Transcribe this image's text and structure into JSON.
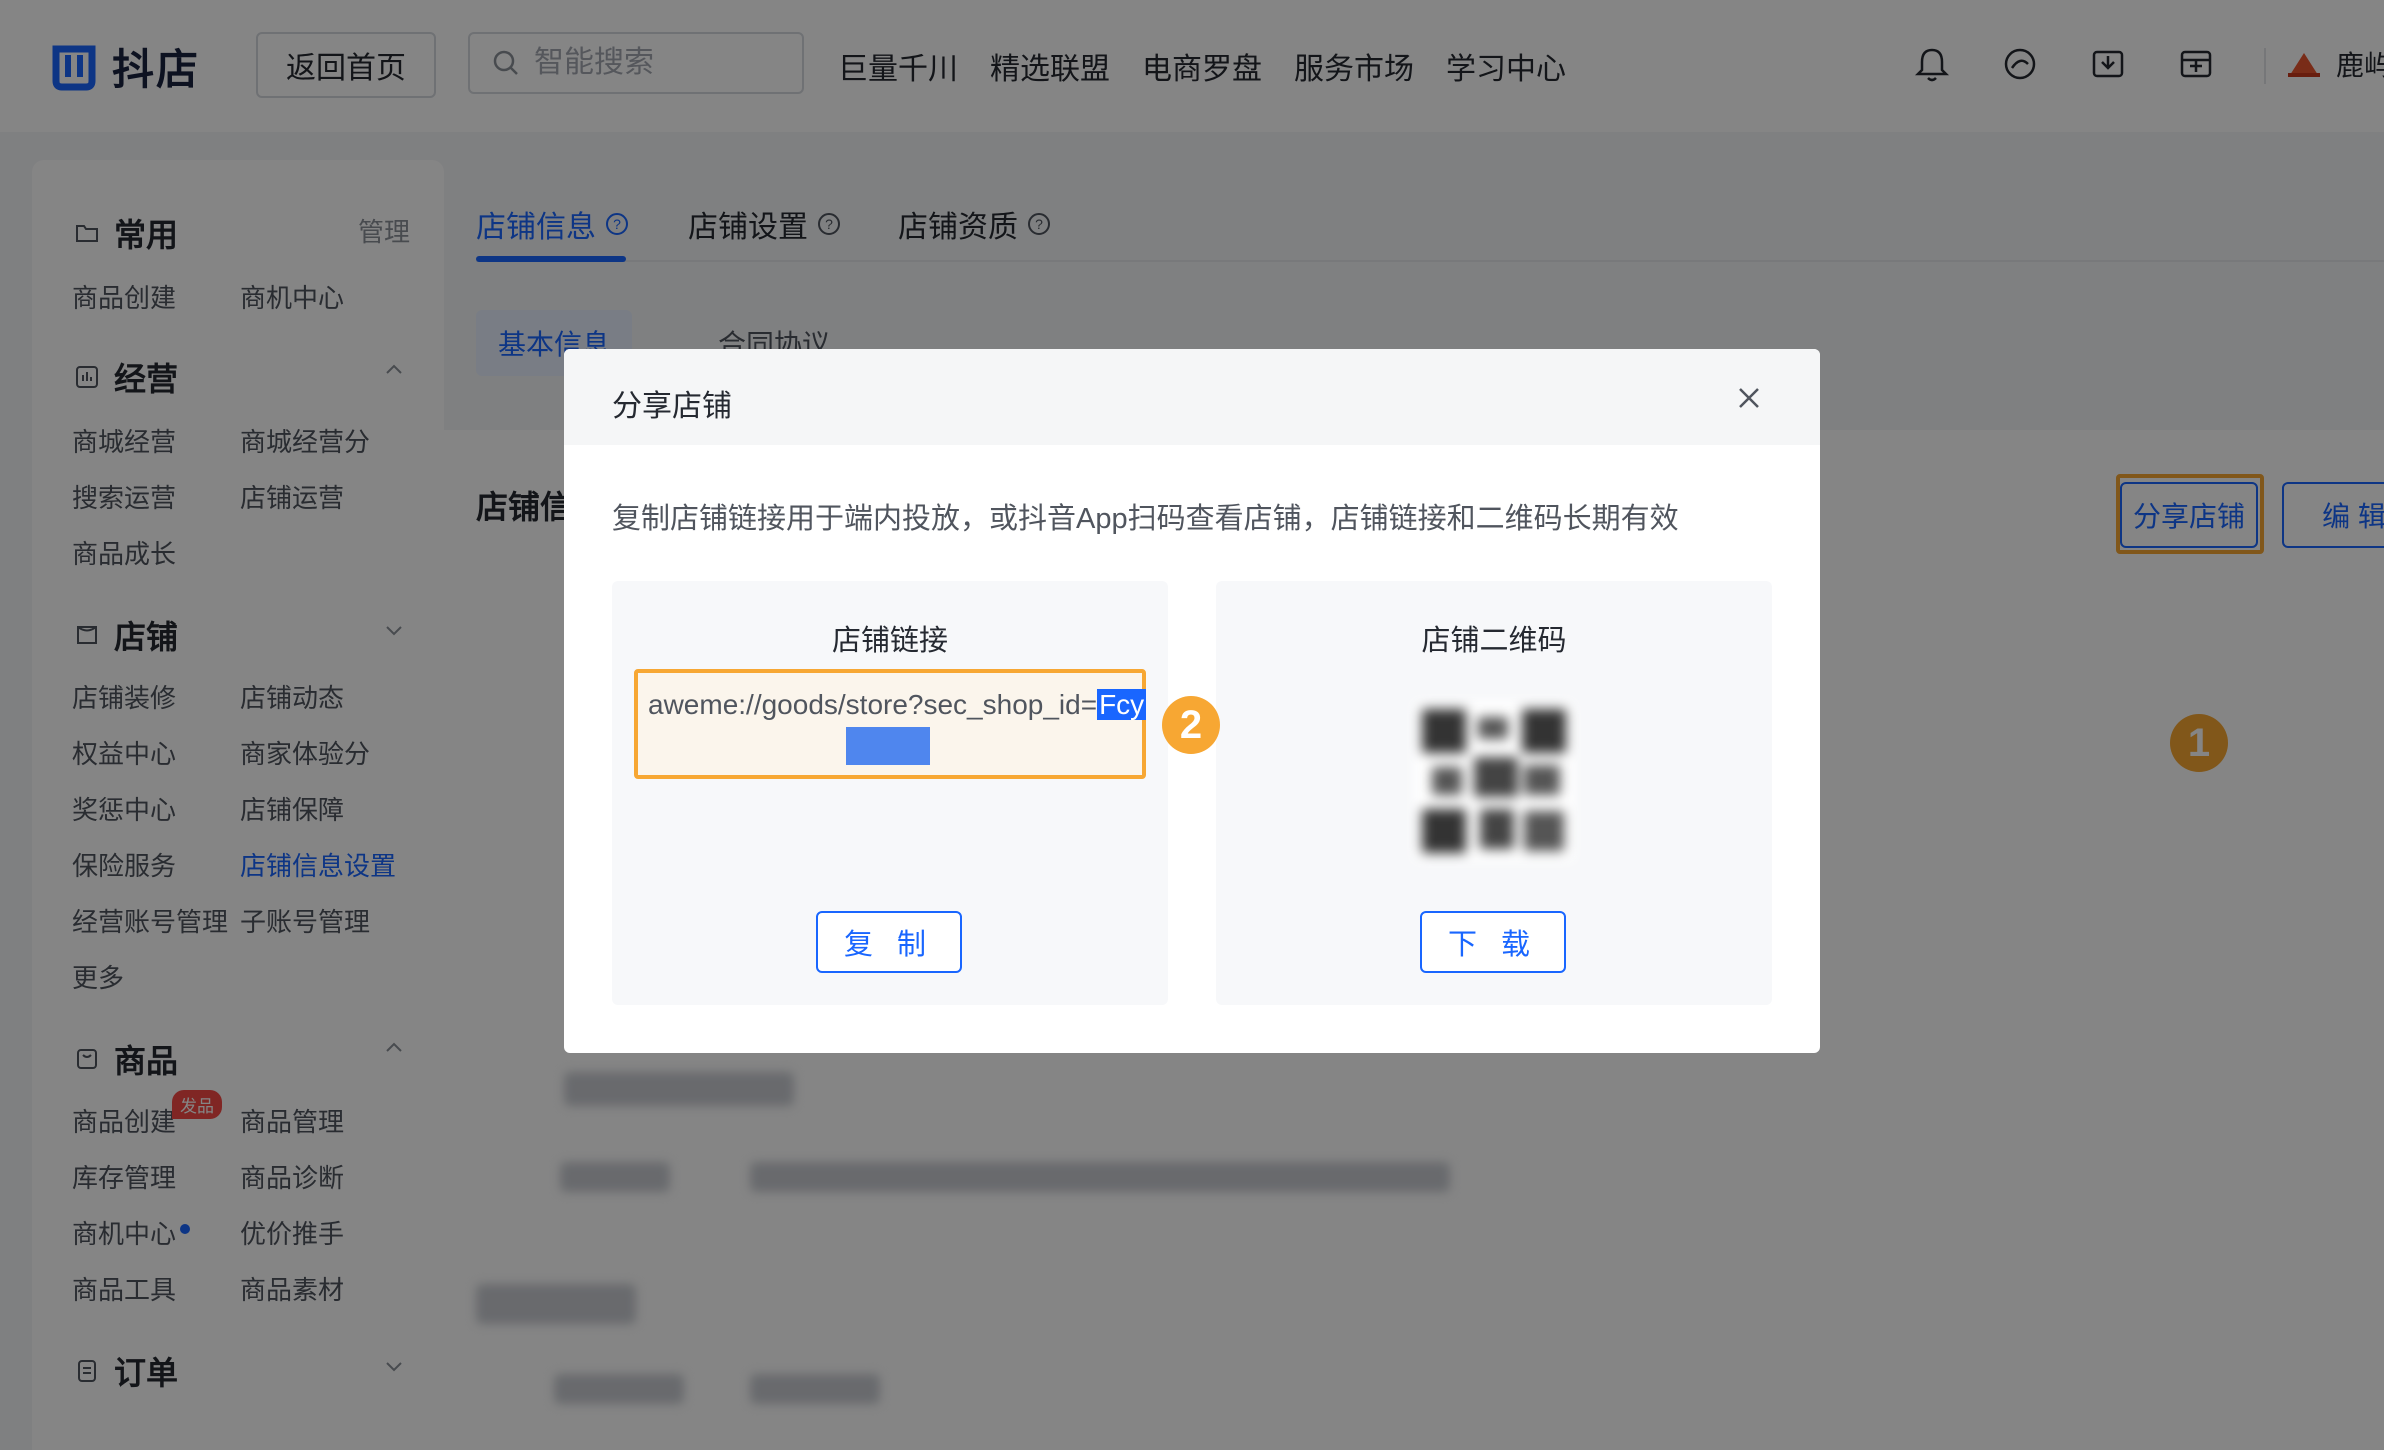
{
  "app": {
    "brand": "抖店",
    "back_home": "返回首页",
    "search_placeholder": "智能搜索",
    "nav": [
      "巨量千川",
      "精选联盟",
      "电商罗盘",
      "服务市场",
      "学习中心"
    ],
    "user_name": "鹿屿"
  },
  "sidebar": {
    "manage": "管理",
    "sections": {
      "common": {
        "title": "常用",
        "items": [
          "商品创建",
          "商机中心"
        ]
      },
      "operations": {
        "title": "经营",
        "items": [
          "商城经营",
          "商城经营分",
          "搜索运营",
          "店铺运营",
          "商品成长"
        ]
      },
      "store": {
        "title": "店铺",
        "items": [
          "店铺装修",
          "店铺动态",
          "权益中心",
          "商家体验分",
          "奖惩中心",
          "店铺保障",
          "保险服务",
          "店铺信息设置",
          "经营账号管理",
          "子账号管理",
          "更多"
        ]
      },
      "goods": {
        "title": "商品",
        "badge": "发品",
        "items": [
          "商品创建",
          "商品管理",
          "库存管理",
          "商品诊断",
          "商机中心",
          "优价推手",
          "商品工具",
          "商品素材"
        ]
      },
      "orders": {
        "title": "订单"
      }
    }
  },
  "main": {
    "tabs": [
      "店铺信息",
      "店铺设置",
      "店铺资质"
    ],
    "subtabs": [
      "基本信息",
      "合同协议"
    ],
    "section_title": "店铺信",
    "share_button": "分享店铺",
    "edit_button": "编 辑"
  },
  "annotations": {
    "step1": "1",
    "step2": "2",
    "color": "#f7a733"
  },
  "modal": {
    "title": "分享店铺",
    "description": "复制店铺链接用于端内投放，或抖音App扫码查看店铺，店铺链接和二维码长期有效",
    "link_panel": {
      "title": "店铺链接",
      "link_prefix": "aweme://goods/store?sec_shop_id=",
      "link_selected": "Fcy",
      "copy_button": "复 制"
    },
    "qr_panel": {
      "title": "店铺二维码",
      "download_button": "下 载"
    }
  },
  "colors": {
    "accent": "#1966ff",
    "highlight": "#f7a733",
    "danger": "#f54a45"
  }
}
